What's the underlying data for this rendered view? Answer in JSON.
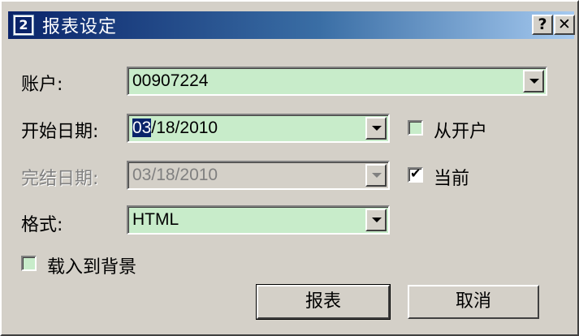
{
  "window": {
    "title": "报表设定",
    "help_label": "?",
    "close_label": "✕",
    "icon_glyph": "2"
  },
  "form": {
    "account_label": "账户:",
    "account_value": "00907224",
    "start_label": "开始日期:",
    "start_value_selected": "03",
    "start_value_rest": "/18/2010",
    "end_label": "完结日期:",
    "end_value": "03/18/2010",
    "format_label": "格式:",
    "format_value": "HTML"
  },
  "checks": {
    "from_open_label": "从开户",
    "from_open_checked": false,
    "current_label": "当前",
    "current_checked": true,
    "background_label": "载入到背景",
    "background_checked": false
  },
  "buttons": {
    "report_label": "报表",
    "cancel_label": "取消"
  },
  "colors": {
    "titlebar_start": "#0a246a",
    "titlebar_end": "#a6caf0",
    "field_bg": "#c8ecca",
    "window_bg": "#d4d0c8"
  }
}
